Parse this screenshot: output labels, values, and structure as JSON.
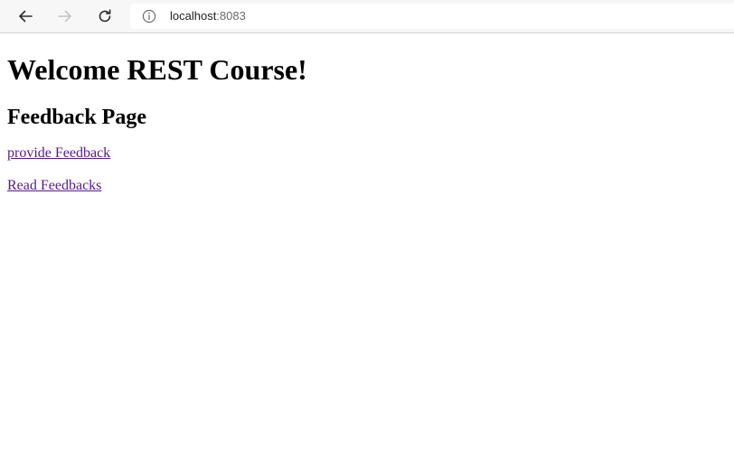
{
  "browser": {
    "url_host": "localhost",
    "url_port": ":8083",
    "icons": {
      "back": "arrow-left-icon",
      "forward": "arrow-right-icon",
      "reload": "reload-icon",
      "site_info": "info-icon"
    },
    "colors": {
      "toolbar_bg": "#f7f7f7",
      "visited_link": "#551a8b"
    }
  },
  "page": {
    "heading": "Welcome REST Course!",
    "subheading": "Feedback Page",
    "links": [
      {
        "label": "provide Feedback"
      },
      {
        "label": "Read Feedbacks"
      }
    ]
  }
}
